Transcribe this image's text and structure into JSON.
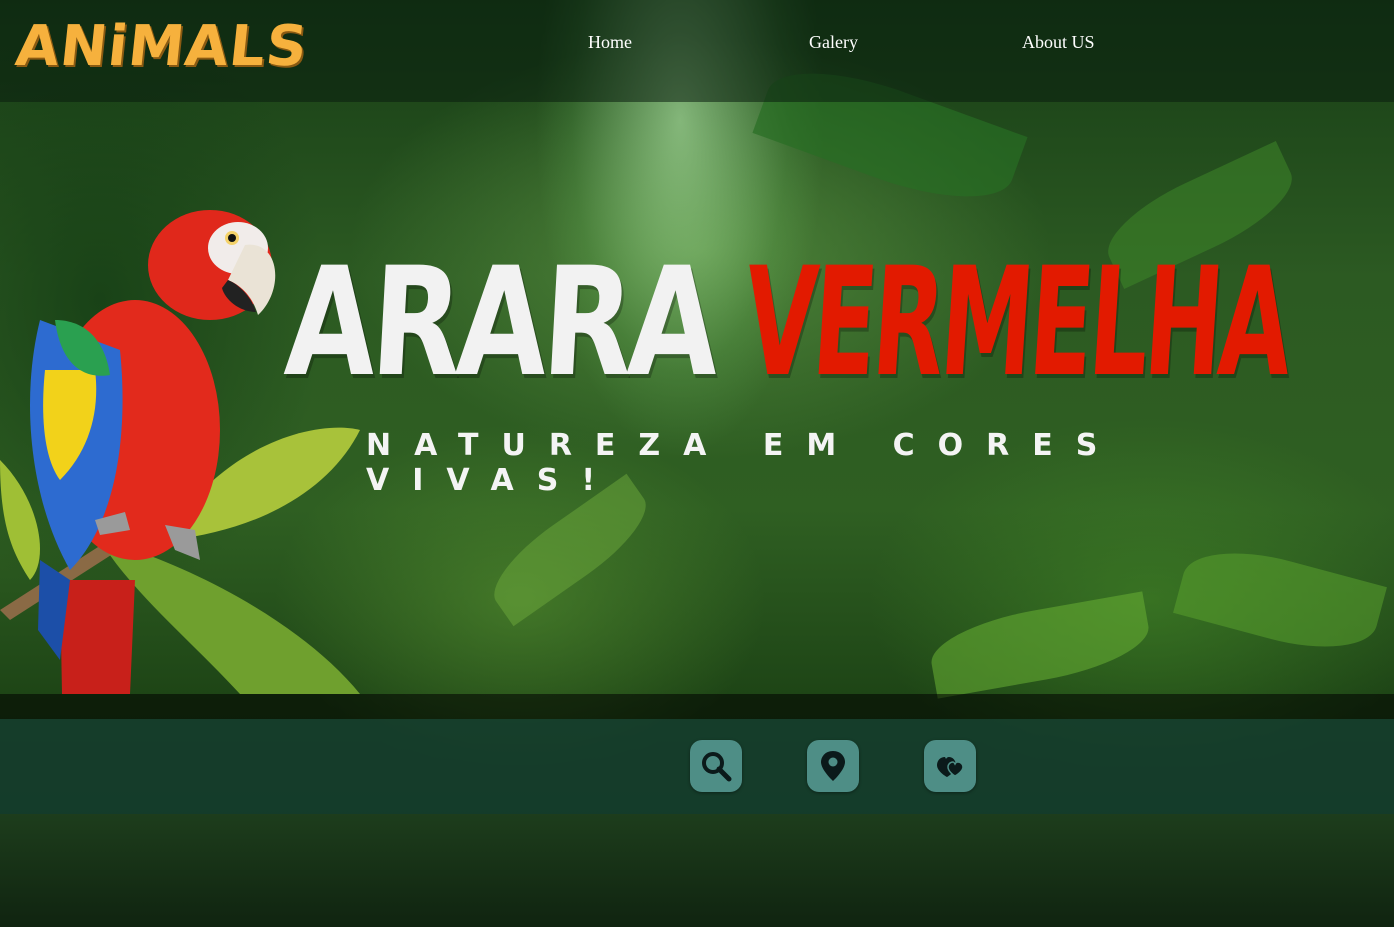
{
  "header": {
    "logo": "ANiMALS",
    "nav": [
      "Home",
      "Galery",
      "About US"
    ]
  },
  "hero": {
    "title_white": "ARARA",
    "title_red": "VERMELHA",
    "subtitle": "NATUREZA EM CORES VIVAS!"
  },
  "actions": {
    "icons": [
      "search-icon",
      "location-pin-icon",
      "heart-favorites-icon"
    ]
  },
  "colors": {
    "logo": "#f6b13d",
    "title_red": "#e21a00",
    "icon_button": "#4e8e86",
    "icon_bar": "#14403a"
  }
}
